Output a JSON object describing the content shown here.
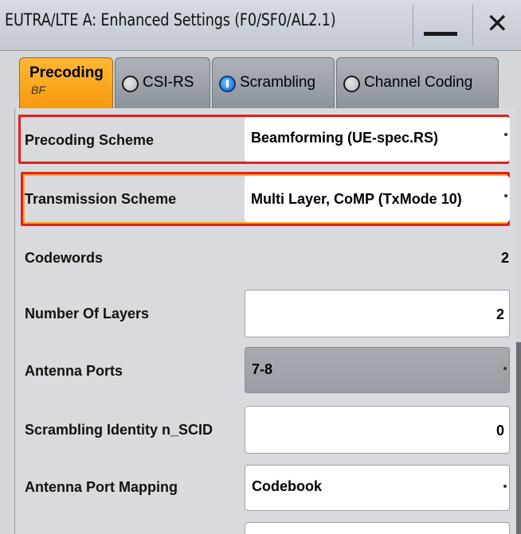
{
  "window": {
    "title": "EUTRA/LTE A: Enhanced Settings (F0/SF0/AL2.1)"
  },
  "tabs": [
    {
      "label": "Precoding",
      "sublabel": "BF",
      "active": true
    },
    {
      "label": "CSI-RS",
      "led": "off"
    },
    {
      "label": "Scrambling",
      "led": "on"
    },
    {
      "label": "Channel Coding",
      "led": "off"
    }
  ],
  "settings": {
    "precoding_scheme": {
      "label": "Precoding Scheme",
      "value": "Beamforming (UE-spec.RS)"
    },
    "transmission_scheme": {
      "label": "Transmission Scheme",
      "value": "Multi Layer, CoMP (TxMode 10)"
    },
    "codewords": {
      "label": "Codewords",
      "value": "2"
    },
    "number_of_layers": {
      "label": "Number Of Layers",
      "value": "2"
    },
    "antenna_ports": {
      "label": "Antenna Ports",
      "value": "7-8"
    },
    "scrambling_identity": {
      "label": "Scrambling Identity n_SCID",
      "value": "0"
    },
    "antenna_port_mapping": {
      "label": "Antenna Port Mapping",
      "value": "Codebook"
    }
  },
  "colors": {
    "active_tab": "#f79a0d",
    "highlight_border": "#e02020",
    "led_on": "#0a62c9"
  }
}
